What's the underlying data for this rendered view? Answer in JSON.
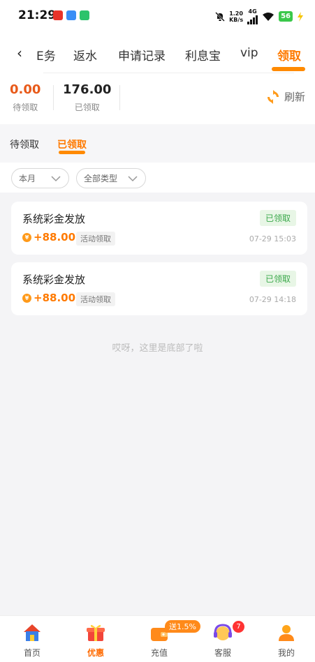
{
  "status_bar": {
    "time": "21:29",
    "net_speed": "1.20",
    "net_unit": "KB/s",
    "signal_type": "4G",
    "battery": "56"
  },
  "nav": {
    "back_icon": "chevron-left-icon",
    "tabs": [
      {
        "label": "任务",
        "partial": "E务"
      },
      {
        "label": "返水"
      },
      {
        "label": "申请记录"
      },
      {
        "label": "利息宝"
      },
      {
        "label": "vip"
      },
      {
        "label": "领取"
      }
    ],
    "active_tab": "领取"
  },
  "summary": {
    "pending_value": "0.00",
    "pending_label": "待领取",
    "received_value": "176.00",
    "received_label": "已领取",
    "refresh_label": "刷新"
  },
  "subtabs": [
    {
      "label": "待领取"
    },
    {
      "label": "已领取"
    }
  ],
  "active_subtab": "已领取",
  "filters": {
    "period": "本月",
    "type": "全部类型"
  },
  "records": [
    {
      "title": "系统彩金发放",
      "status": "已领取",
      "amount": "+88.00",
      "tag": "活动领取",
      "time": "07-29 15:03"
    },
    {
      "title": "系统彩金发放",
      "status": "已领取",
      "amount": "+88.00",
      "tag": "活动领取",
      "time": "07-29 14:18"
    }
  ],
  "coin_symbol": "¥",
  "end_text": "哎呀，这里是底部了啦",
  "bottom_nav": [
    {
      "label": "首页",
      "icon": "home-icon"
    },
    {
      "label": "优惠",
      "icon": "gift-icon"
    },
    {
      "label": "充值",
      "icon": "wallet-icon"
    },
    {
      "label": "客服",
      "icon": "headset-icon"
    },
    {
      "label": "我的",
      "icon": "user-icon"
    }
  ],
  "recharge_promo": "送1.5%",
  "service_badge": "7",
  "colors": {
    "accent": "#ff7a00",
    "success": "#3aa84a",
    "pending_value": "#e85a1a"
  }
}
